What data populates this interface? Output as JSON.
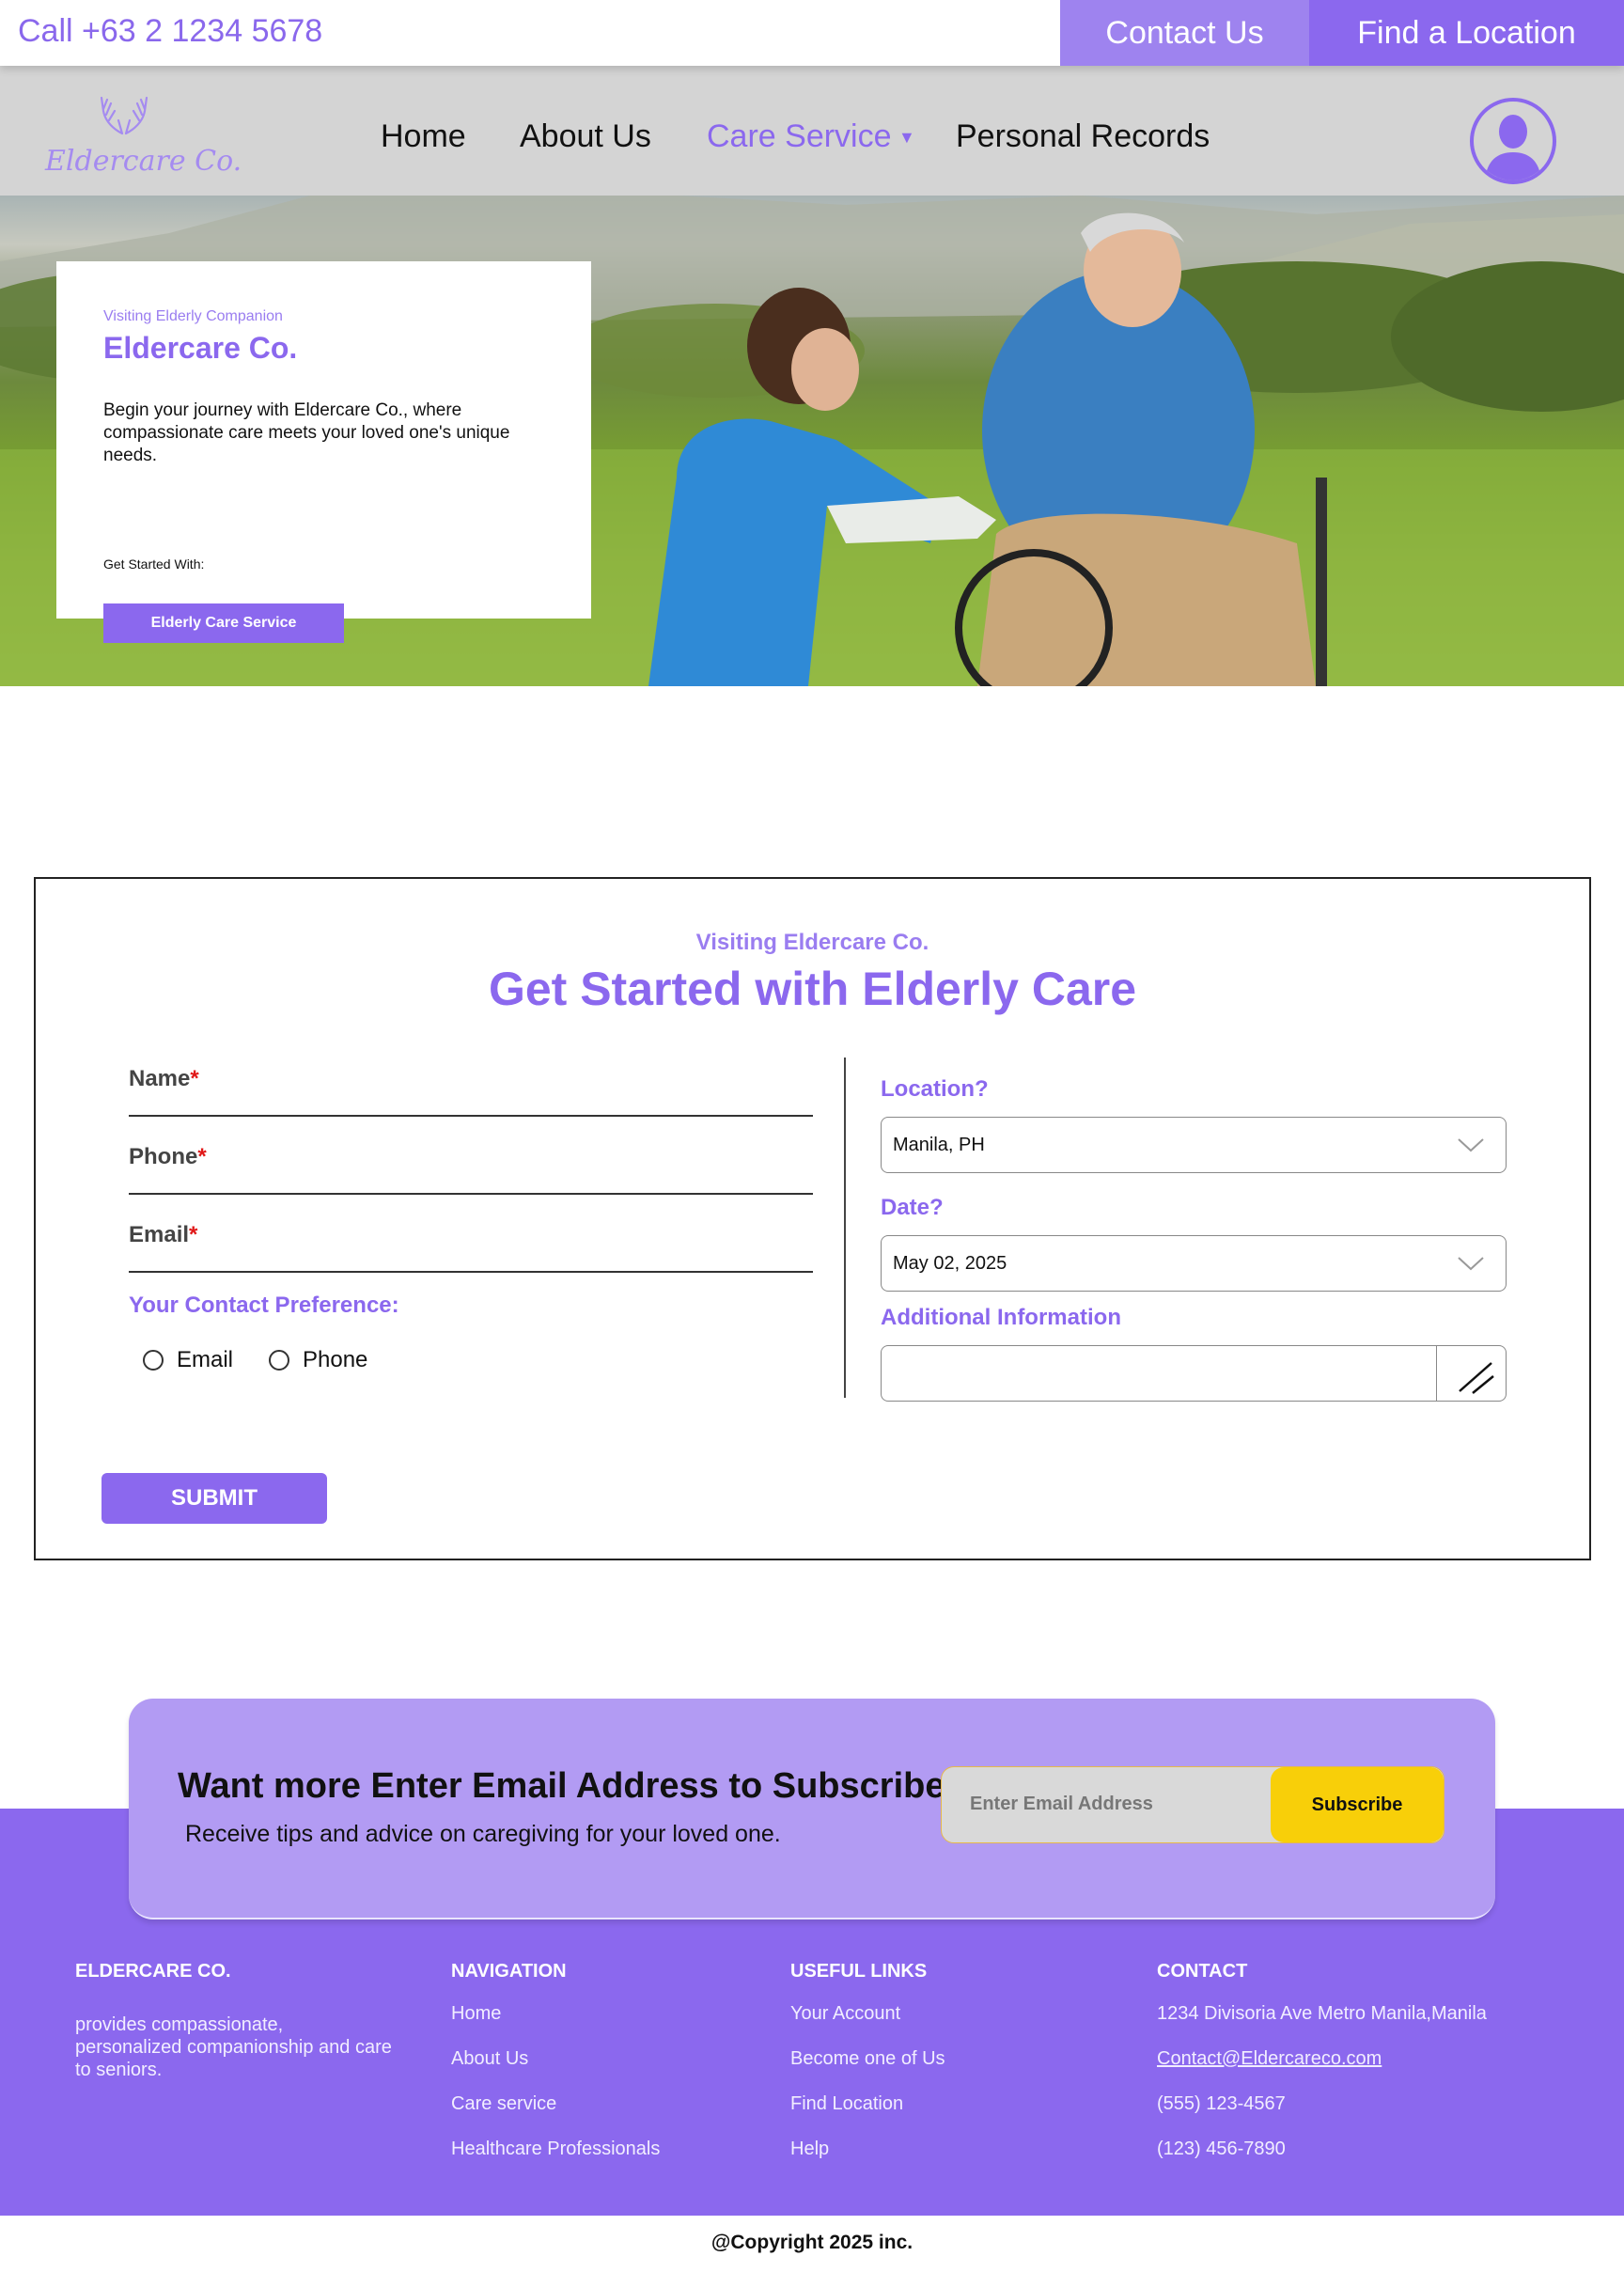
{
  "topbar": {
    "call": "Call +63 2 1234 5678",
    "contact_us": "Contact Us",
    "find_location": "Find a Location"
  },
  "nav": {
    "logo_text": "Eldercare Co.",
    "items": [
      "Home",
      "About Us",
      "Care Service",
      "Personal Records"
    ],
    "active": "Care Service"
  },
  "hero": {
    "eyebrow": "Visiting Elderly Companion",
    "title": "Eldercare Co.",
    "description": "Begin your journey with Eldercare Co., where compassionate care meets your loved one's unique needs.",
    "get_started": "Get Started With:",
    "cta": "Elderly Care Service"
  },
  "form": {
    "eyebrow": "Visiting Eldercare Co.",
    "heading": "Get Started with Elderly Care",
    "fields": [
      {
        "label": "Name",
        "required": "*"
      },
      {
        "label": "Phone",
        "required": "*"
      },
      {
        "label": "Email",
        "required": "*"
      }
    ],
    "contact_pref_label": "Your Contact Preference:",
    "contact_options": [
      "Email",
      "Phone"
    ],
    "location_label": "Location?",
    "location_value": "Manila, PH",
    "date_label": "Date?",
    "date_value": "May 02, 2025",
    "additional_label": "Additional Information",
    "additional_value": "",
    "submit": "SUBMIT"
  },
  "subscribe": {
    "title": "Want more Enter Email Address to Subscribe",
    "description": "Receive tips and advice on caregiving for your loved one.",
    "placeholder": "Enter Email Address",
    "button": "Subscribe"
  },
  "footer": {
    "brand_title": "ELDERCARE CO.",
    "brand_desc": "provides compassionate, personalized companionship and care to seniors.",
    "nav_title": "NAVIGATION",
    "nav_links": [
      "Home",
      "About Us",
      "Care service",
      "Healthcare Professionals"
    ],
    "useful_title": "USEFUL LINKS",
    "useful_links": [
      "Your Account",
      "Become one of Us",
      "Find Location",
      "Help"
    ],
    "contact_title": "CONTACT",
    "contact_items": [
      "1234 Divisoria Ave Metro Manila,Manila",
      "Contact@Eldercareco.com",
      "(555) 123-4567",
      "(123) 456-7890"
    ],
    "copyright": "@Copyright 2025 inc."
  },
  "colors": {
    "brand_purple": "#8b68ee",
    "light_purple": "#b29bf3",
    "subscribe_yellow": "#f8cf09",
    "required_red": "#e01818"
  },
  "icons": {
    "logo": "caring-hands-icon",
    "avatar": "user-silhouette-icon",
    "select_arrow": "chevron-down-icon",
    "resize": "resize-handle-icon"
  }
}
